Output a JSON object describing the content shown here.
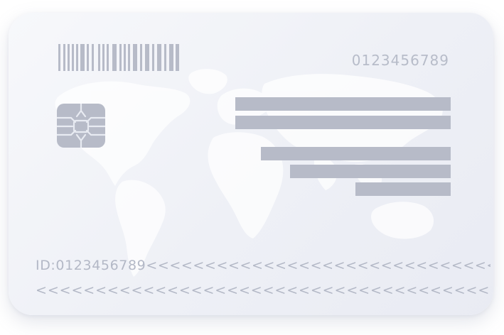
{
  "card": {
    "top_number": "0123456789",
    "mrz_line_1": "ID:0123456789<<<<<<<<<<<<<<<<<<<<<<<<<<<<<<<<<<<",
    "mrz_line_2": "<<<<<<<<<<<<<<<<<<<<<<<<<<<<<<<<<<<<<<<<<<<<<<<<<<<"
  },
  "icons": {
    "barcode": "barcode-icon",
    "chip": "chip-icon",
    "map": "world-map"
  },
  "colors": {
    "card_background": "#eef0f6",
    "graphics": "#b7bbc8",
    "text": "#b3b8c6",
    "map": "#ffffff"
  }
}
